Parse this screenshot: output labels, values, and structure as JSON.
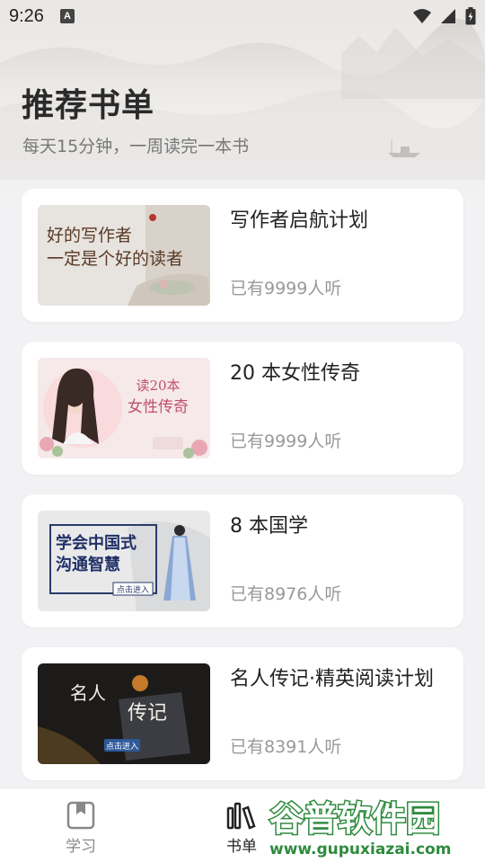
{
  "status_bar": {
    "time": "9:26",
    "notification_letter": "A"
  },
  "header": {
    "title": "推荐书单",
    "subtitle": "每天15分钟，一周读完一本书"
  },
  "booklists": [
    {
      "title": "写作者启航计划",
      "listeners": "已有9999人听",
      "cover_text_line1": "好的写作者",
      "cover_text_line2": "一定是个好的读者"
    },
    {
      "title": "20 本女性传奇",
      "listeners": "已有9999人听",
      "cover_text_line1": "读20本",
      "cover_text_line2": "女性传奇"
    },
    {
      "title": "8 本国学",
      "listeners": "已有8976人听",
      "cover_text_line1": "学会中国式",
      "cover_text_line2": "沟通智慧",
      "cover_button": "点击进入"
    },
    {
      "title": "名人传记·精英阅读计划",
      "listeners": "已有8391人听",
      "cover_text_line1": "名人",
      "cover_text_line2": "传记",
      "cover_button": "点击进入"
    }
  ],
  "tabbar": {
    "items": [
      {
        "label": "学习",
        "icon": "bookmark-book-icon",
        "active": false
      },
      {
        "label": "书单",
        "icon": "bookshelf-icon",
        "active": true
      }
    ]
  },
  "watermark": {
    "text_cn": "谷普软件园",
    "text_url": "www.gupuxiazai.com"
  },
  "colors": {
    "background": "#f2f2f4",
    "card": "#ffffff",
    "title": "#222222",
    "secondary": "#999999",
    "tab_inactive": "#888888",
    "watermark_green": "#2e8b3e"
  }
}
